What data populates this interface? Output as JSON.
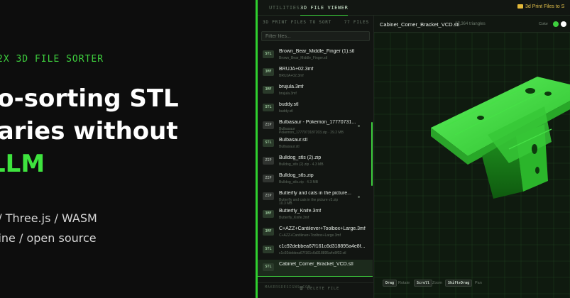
{
  "hero": {
    "eyebrow": "2X 3D FILE SORTER",
    "headline_line1": "to-sorting STL",
    "headline_line2": "raries without",
    "headline_accent": "LLM",
    "tech_line1": "n  /  Three.js  /  WASM",
    "tech_line2": "ffline  /  open source"
  },
  "topbar": {
    "tabs": [
      "UTILITIES",
      "3D FILE VIEWER"
    ],
    "active_tab": "3D FILE VIEWER",
    "folder_label": "3d Print Files to S"
  },
  "sidebar": {
    "heading": "3D PRINT FILES TO SORT",
    "count": "77 FILES",
    "filter_placeholder": "Filter files...",
    "files": [
      {
        "type": "STL",
        "name": "Brown_Bear_Middle_Finger (1).stl",
        "sub": "Brown_Bear_Middle_Finger.stl"
      },
      {
        "type": "3MF",
        "name": "BRUJA+02.3mf",
        "sub": "BRUJA+02.3mf"
      },
      {
        "type": "3MF",
        "name": "brujula.3mf",
        "sub": "brujula.3mf"
      },
      {
        "type": "STL",
        "name": "buddy.stl",
        "sub": "buddy.stl"
      },
      {
        "type": "ZIP",
        "name": "Bulbasaur - Pokemon_17770731...",
        "sub": "Bulbasaur",
        "sub2": "Pokemon_1777073187203.zip · 29.2 MB"
      },
      {
        "type": "STL",
        "name": "Bulbasaur.stl",
        "sub": "Bulbasaur.stl"
      },
      {
        "type": "ZIP",
        "name": "Bulldog_stls (2).zip",
        "sub": "Bulldog_stls (2).zip · 4.3 MB"
      },
      {
        "type": "ZIP",
        "name": "Bulldog_stls.zip",
        "sub": "Bulldog_stls.zip · 4.3 MB"
      },
      {
        "type": "ZIP",
        "name": "Butterfly and cats in the picture...",
        "sub": "Butterfly and cats in the picture v3.zip",
        "sub2": "10.3 MB"
      },
      {
        "type": "3MF",
        "name": "Butterfly_Knife.3mf",
        "sub": "Butterfly_Knife.3mf"
      },
      {
        "type": "3MF",
        "name": "C+AZZ+Cantilever+Toolbox+Large.3mf",
        "sub": "C+AZZ+Cantilever+Toolbox+Large.3mf"
      },
      {
        "type": "STL",
        "name": "c1c92debbea67f161c6d318895a4e8f...",
        "sub": "c1c92debbea67f161c6d318895a4e8f02.stl"
      },
      {
        "type": "STL",
        "name": "Cabinet_Corner_Bracket_VCD.stl",
        "sub": ""
      }
    ],
    "footer_text": "MAKERSDESIGNS.COM",
    "delete_label": "DELETE FILE"
  },
  "viewer": {
    "file_title": "Cabinet_Corner_Bracket_VCD.stl",
    "triangles": "37,364 triangles",
    "color_label": "Color",
    "swatch_colors": [
      "#3ecf3e",
      "#ffffff"
    ],
    "hints": {
      "drag_key": "Drag",
      "drag_action": "Rotate",
      "scroll_key": "Scroll",
      "scroll_action": "Zoom",
      "shift_key": "Shift+Drag",
      "shift_action": "Pan"
    }
  },
  "colors": {
    "accent": "#3ecf3e",
    "model": "#34d034",
    "folder": "#e3c14b"
  }
}
